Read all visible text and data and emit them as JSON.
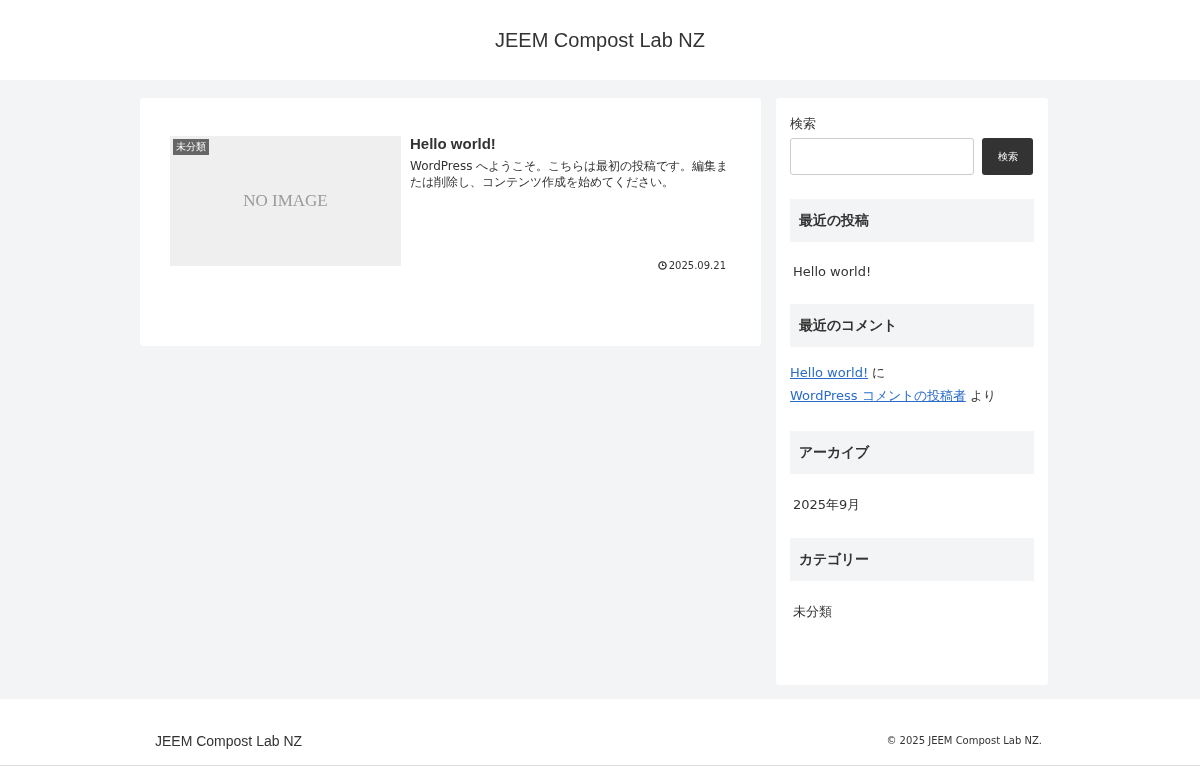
{
  "header": {
    "site_title": "JEEM Compost Lab NZ"
  },
  "posts": [
    {
      "category": "未分類",
      "thumbnail_text": "NO IMAGE",
      "title": "Hello world!",
      "excerpt": "WordPress へようこそ。こちらは最初の投稿です。編集または削除し、コンテンツ作成を始めてください。",
      "date": "2025.09.21"
    }
  ],
  "sidebar": {
    "search": {
      "label": "検索",
      "button": "検索"
    },
    "widgets": [
      {
        "kind": "list",
        "title": "最近の投稿",
        "items": [
          "Hello world!"
        ]
      },
      {
        "kind": "comments",
        "title": "最近のコメント",
        "comments": [
          {
            "post": "Hello world!",
            "connector": "に",
            "author": "WordPress コメントの投稿者",
            "suffix": "より"
          }
        ]
      },
      {
        "kind": "list",
        "title": "アーカイブ",
        "items": [
          "2025年9月"
        ]
      },
      {
        "kind": "list",
        "title": "カテゴリー",
        "items": [
          "未分類"
        ]
      }
    ]
  },
  "footer": {
    "site_title": "JEEM Compost Lab NZ",
    "copyright": "© 2025 JEEM Compost Lab NZ."
  }
}
